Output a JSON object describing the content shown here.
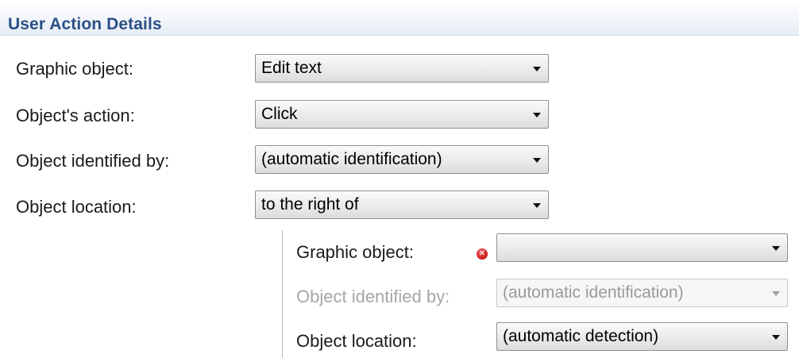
{
  "section": {
    "title": "User Action Details"
  },
  "fields": {
    "graphic_object": {
      "label": "Graphic object:",
      "value": "Edit text"
    },
    "object_action": {
      "label": "Object's action:",
      "value": "Click"
    },
    "identified_by": {
      "label": "Object identified by:",
      "value": "(automatic identification)"
    },
    "location": {
      "label": "Object location:",
      "value": "to the right of"
    }
  },
  "relative": {
    "graphic_object": {
      "label": "Graphic object:",
      "value": ""
    },
    "identified_by": {
      "label": "Object identified by:",
      "value": "(automatic identification)",
      "enabled": false
    },
    "location": {
      "label": "Object location:",
      "value": "(automatic detection)"
    }
  },
  "icons": {
    "error": "error-icon"
  },
  "colors": {
    "header_text": "#2b4f86",
    "error": "#d0221f",
    "disabled_text": "#a6a6a6"
  }
}
